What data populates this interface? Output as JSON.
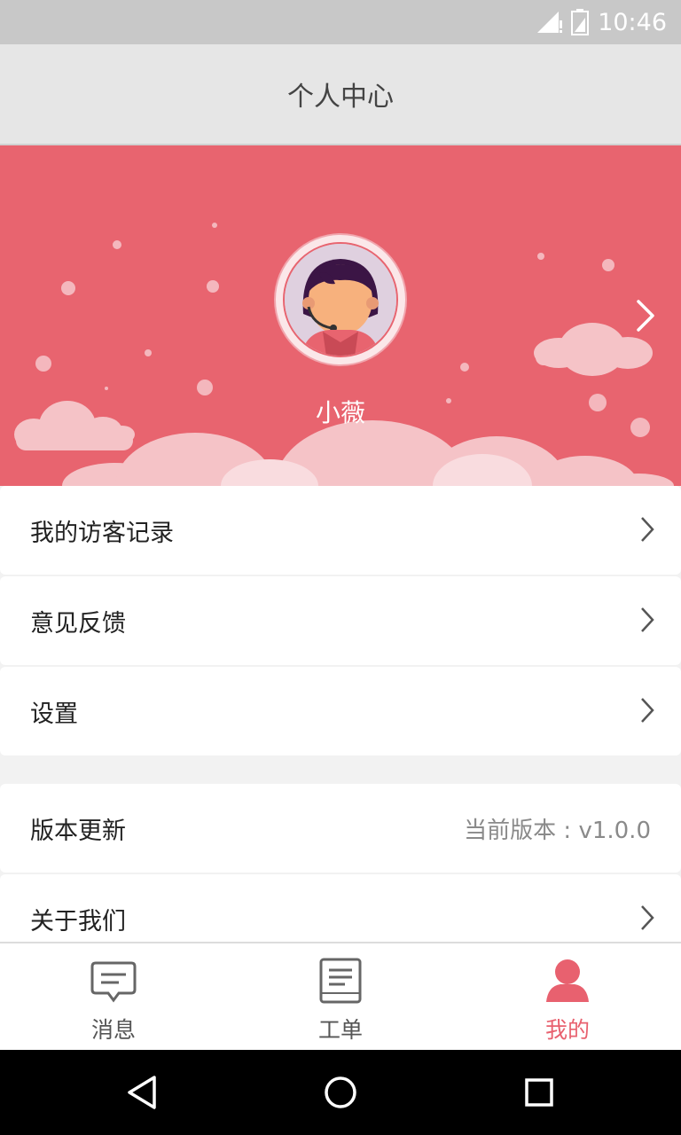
{
  "status_bar": {
    "time": "10:46",
    "signal_icon": "signal-icon",
    "battery_icon": "battery-icon"
  },
  "header": {
    "title": "个人中心"
  },
  "profile": {
    "name": "小薇",
    "avatar_icon": "avatar-icon",
    "banner_color": "#e8646f"
  },
  "menu_group_1": [
    {
      "label": "我的访客记录"
    },
    {
      "label": "意见反馈"
    },
    {
      "label": "设置"
    }
  ],
  "menu_group_2": [
    {
      "label": "版本更新",
      "value": "当前版本 : v1.0.0"
    },
    {
      "label": "关于我们"
    }
  ],
  "tabs": [
    {
      "label": "消息",
      "icon": "message-icon",
      "active": false
    },
    {
      "label": "工单",
      "icon": "document-icon",
      "active": false
    },
    {
      "label": "我的",
      "icon": "profile-icon",
      "active": true
    }
  ],
  "nav": {
    "back": "back-icon",
    "home": "home-icon",
    "recents": "recents-icon"
  },
  "colors": {
    "accent": "#e8616f",
    "banner": "#e8646f",
    "cloud": "#f5c3c7"
  }
}
